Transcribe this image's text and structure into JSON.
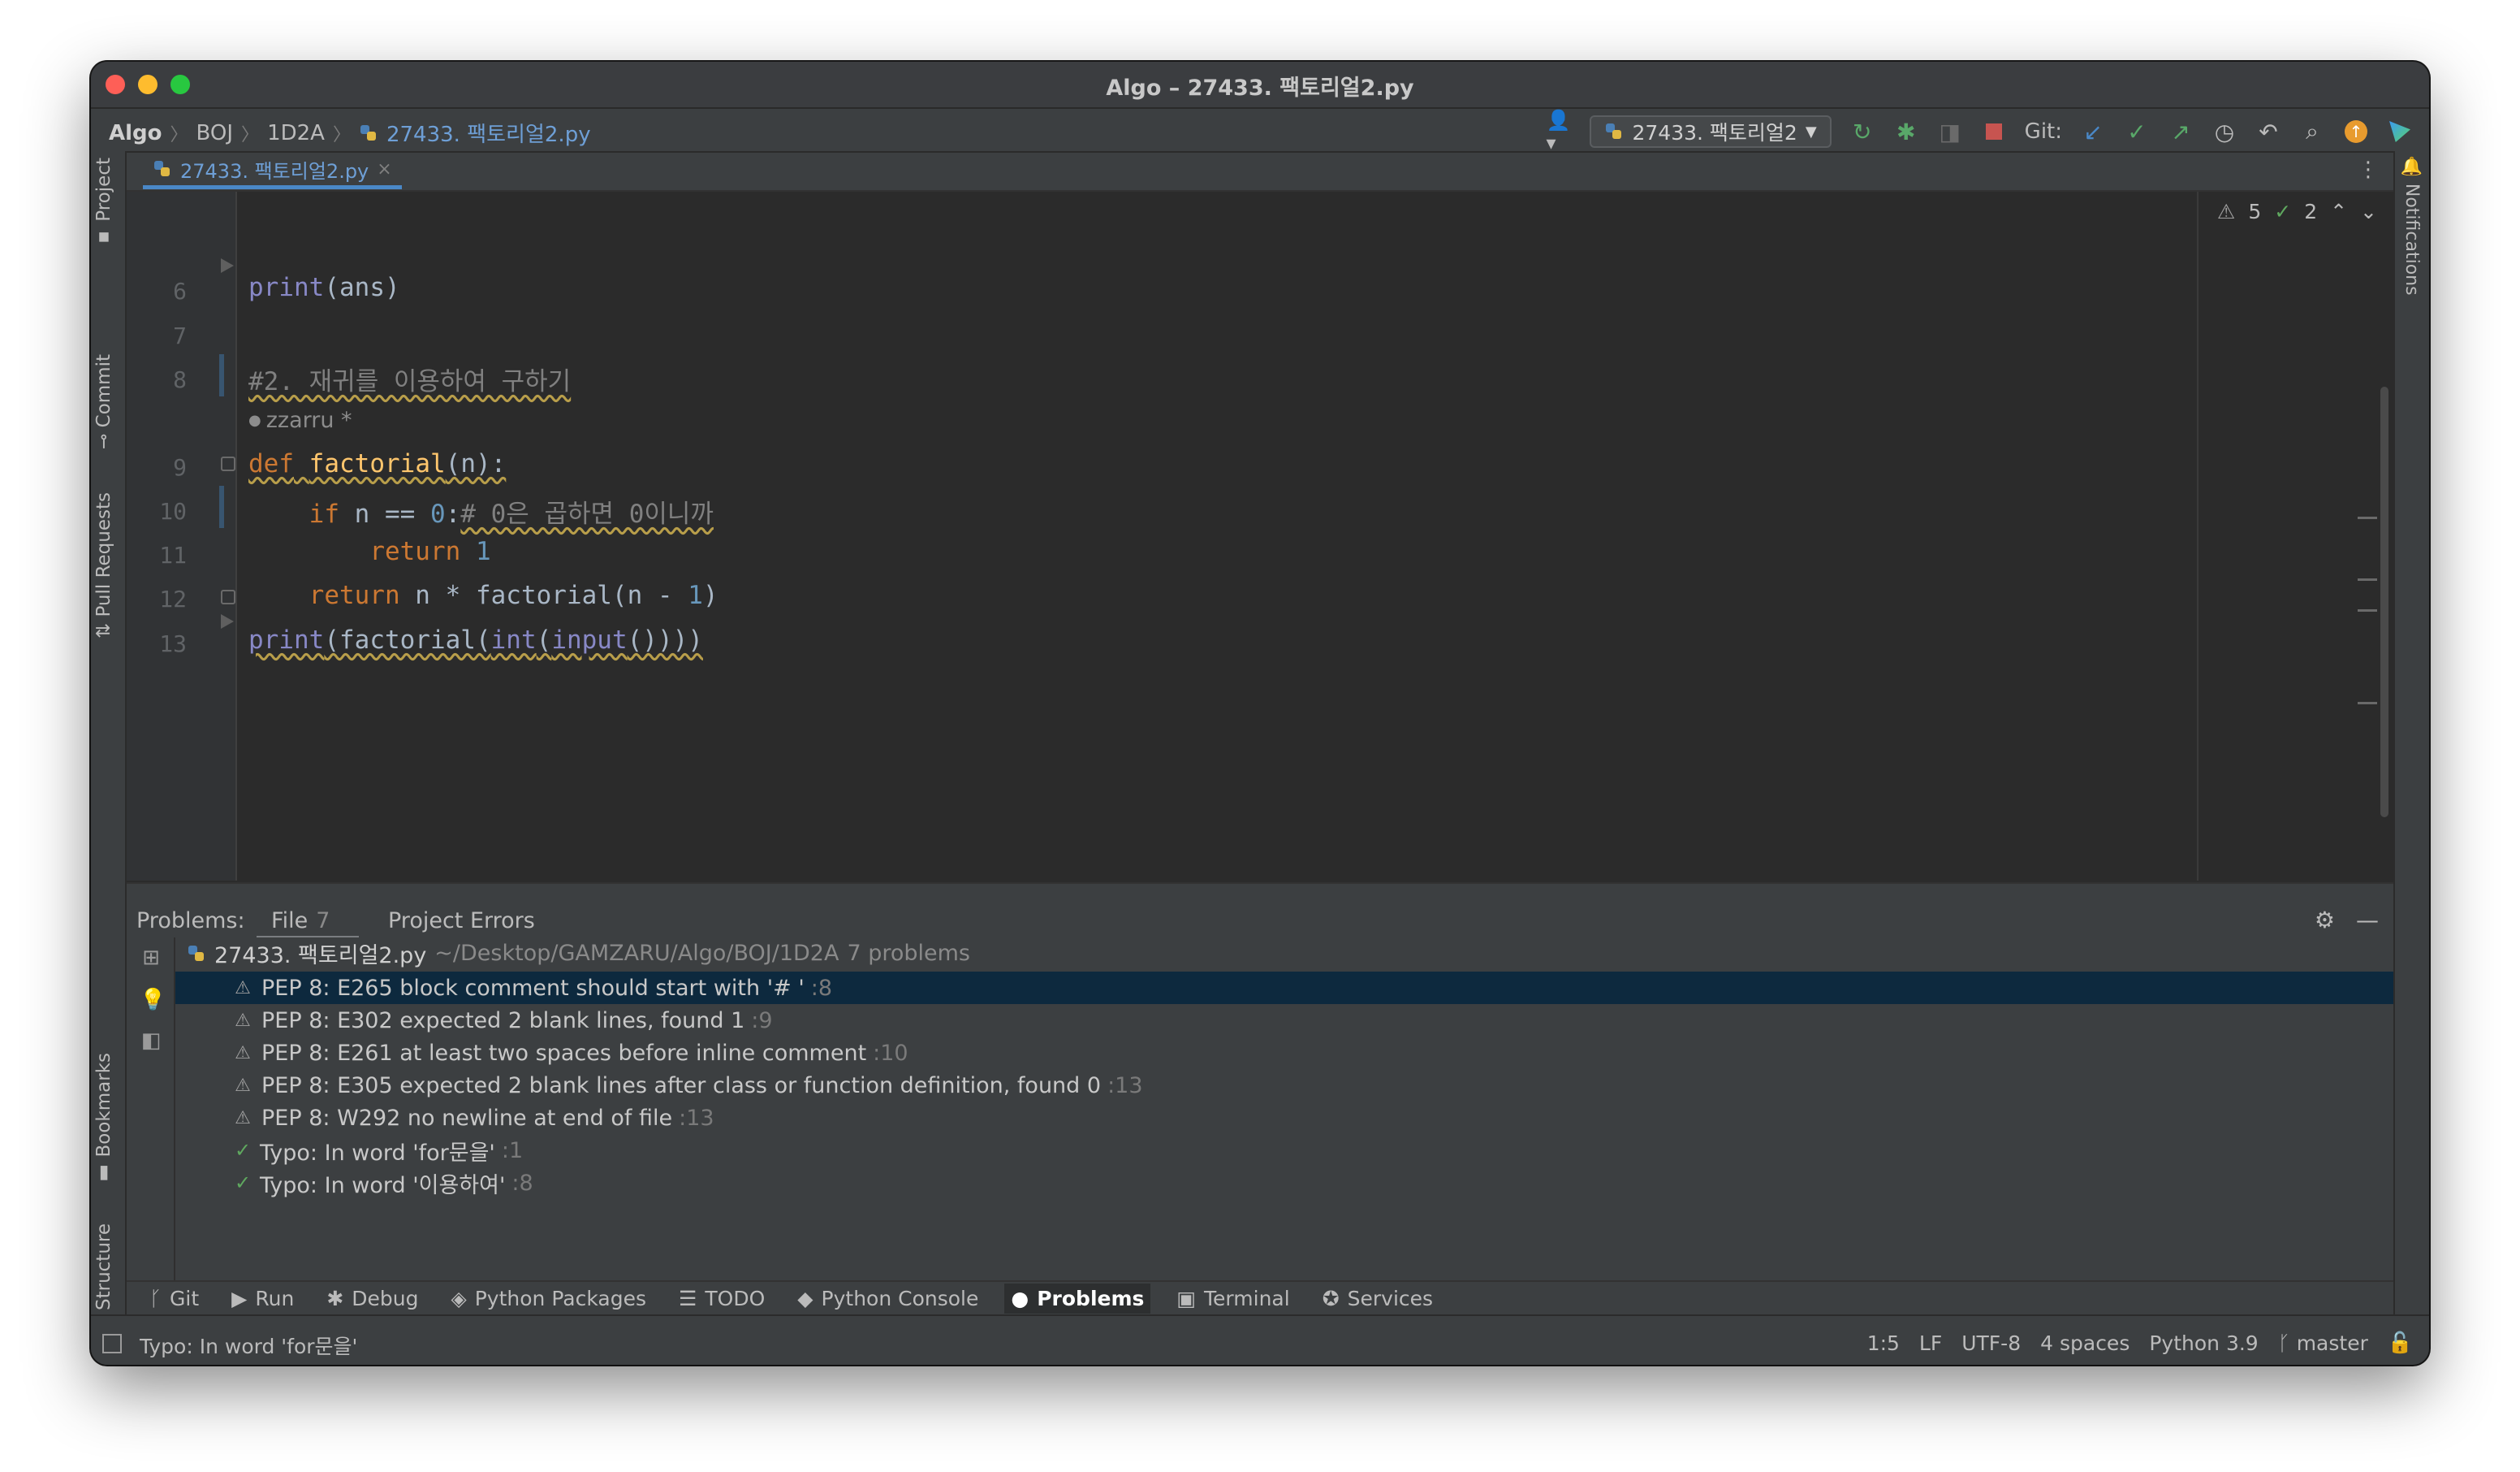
{
  "window": {
    "title": "Algo – 27433. 팩토리얼2.py"
  },
  "navbar": {
    "crumbs": [
      "Algo",
      "BOJ",
      "1D2A"
    ],
    "file": "27433. 팩토리얼2.py",
    "run_config": "27433. 팩토리얼2",
    "git_label": "Git:"
  },
  "left_tabs": {
    "project": "Project",
    "commit": "Commit",
    "pull_requests": "Pull Requests",
    "bookmarks": "Bookmarks",
    "structure": "Structure"
  },
  "right_tabs": {
    "notifications": "Notifications"
  },
  "editor": {
    "tab": "27433. 팩토리얼2.py",
    "inspection": {
      "warnings": "5",
      "typos": "2"
    },
    "author_hint": "zzarru *",
    "lines": [
      {
        "no": "6",
        "text": "print(ans)"
      },
      {
        "no": "7",
        "text": ""
      },
      {
        "no": "8",
        "text": "#2. 재귀를 이용하여 구하기"
      },
      {
        "no": "9",
        "text": "def factorial(n):"
      },
      {
        "no": "10",
        "text": "    if n == 0:# 0은 곱하면 0이니까"
      },
      {
        "no": "11",
        "text": "        return 1"
      },
      {
        "no": "12",
        "text": "    return n * factorial(n - 1)"
      },
      {
        "no": "13",
        "text": "print(factorial(int(input())))"
      }
    ]
  },
  "problems": {
    "label": "Problems:",
    "tab_file": "File",
    "tab_file_count": "7",
    "tab_project": "Project Errors",
    "file_name": "27433. 팩토리얼2.py",
    "file_path": "~/Desktop/GAMZARU/Algo/BOJ/1D2A",
    "count_text": "7 problems",
    "items": [
      {
        "text": "PEP 8: E265 block comment should start with '# '",
        "line": ":8",
        "kind": "warn"
      },
      {
        "text": "PEP 8: E302 expected 2 blank lines, found 1",
        "line": ":9",
        "kind": "warn"
      },
      {
        "text": "PEP 8: E261 at least two spaces before inline comment",
        "line": ":10",
        "kind": "warn"
      },
      {
        "text": "PEP 8: E305 expected 2 blank lines after class or function definition, found 0",
        "line": ":13",
        "kind": "warn"
      },
      {
        "text": "PEP 8: W292 no newline at end of file",
        "line": ":13",
        "kind": "warn"
      },
      {
        "text": "Typo: In word 'for문을'",
        "line": ":1",
        "kind": "typo"
      },
      {
        "text": "Typo: In word '이용하여'",
        "line": ":8",
        "kind": "typo"
      }
    ]
  },
  "toolwindows": [
    "Git",
    "Run",
    "Debug",
    "Python Packages",
    "TODO",
    "Python Console",
    "Problems",
    "Terminal",
    "Services"
  ],
  "status": {
    "message": "Typo: In word 'for문을'",
    "position": "1:5",
    "line_sep": "LF",
    "encoding": "UTF-8",
    "indent": "4 spaces",
    "interpreter": "Python 3.9",
    "branch": "master"
  },
  "colors": {
    "accent": "#4a88c7",
    "selection": "#0d293e",
    "keyword": "#cc7832",
    "function": "#ffc66d",
    "number": "#6897bb"
  }
}
